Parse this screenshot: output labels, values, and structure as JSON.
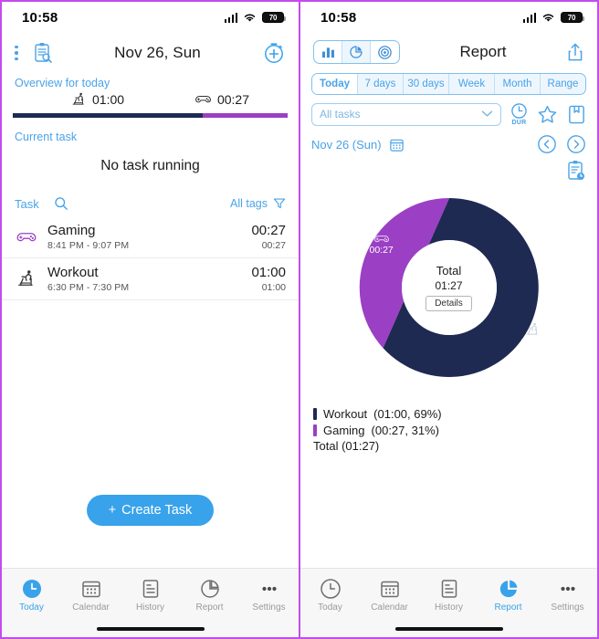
{
  "colors": {
    "accent_blue": "#38a2ea",
    "light_blue": "#4aa3e8",
    "navy": "#1e2a52",
    "purple": "#9b3fc4",
    "frame_border": "#c44bf0"
  },
  "status_bar": {
    "time": "10:58",
    "battery": "70"
  },
  "left": {
    "header": {
      "title": "Nov 26, Sun"
    },
    "overview": {
      "label": "Overview for today",
      "items": [
        {
          "icon": "treadmill-icon",
          "value": "01:00",
          "percent": 69
        },
        {
          "icon": "gamepad-icon",
          "value": "00:27",
          "percent": 31
        }
      ]
    },
    "current_task": {
      "label": "Current task",
      "status": "No task running"
    },
    "task_list": {
      "header_label": "Task",
      "tags_label": "All tags",
      "rows": [
        {
          "icon": "gamepad-icon",
          "name": "Gaming",
          "range": "8:41 PM - 9:07 PM",
          "duration": "00:27",
          "sub": "00:27"
        },
        {
          "icon": "treadmill-icon",
          "name": "Workout",
          "range": "6:30 PM - 7:30 PM",
          "duration": "01:00",
          "sub": "01:00"
        }
      ]
    },
    "create_button": {
      "plus": "+",
      "label": "Create Task"
    },
    "tabs": [
      {
        "label": "Today",
        "icon": "clock-icon",
        "active": true
      },
      {
        "label": "Calendar",
        "icon": "calendar-icon",
        "active": false
      },
      {
        "label": "History",
        "icon": "document-icon",
        "active": false
      },
      {
        "label": "Report",
        "icon": "pie-chart-icon",
        "active": false
      },
      {
        "label": "Settings",
        "icon": "ellipsis-icon",
        "active": false
      }
    ]
  },
  "right": {
    "header": {
      "title": "Report"
    },
    "chart_type_tabs": [
      {
        "icon": "bar-chart-icon",
        "active": false
      },
      {
        "icon": "pie-chart-icon",
        "active": true
      },
      {
        "icon": "target-icon",
        "active": false
      }
    ],
    "period_tabs": [
      {
        "label": "Today",
        "active": true
      },
      {
        "label": "7 days",
        "active": false
      },
      {
        "label": "30 days",
        "active": false
      },
      {
        "label": "Week",
        "active": false
      },
      {
        "label": "Month",
        "active": false
      },
      {
        "label": "Range",
        "active": false
      }
    ],
    "task_filter": {
      "value": "All tasks"
    },
    "dur_toggle": {
      "label": "DUR",
      "icon": "clock-icon"
    },
    "date_nav": {
      "date": "Nov 26 (Sun)",
      "prev": "‹",
      "next": "›"
    },
    "donut_center": {
      "title": "Total",
      "value": "01:27",
      "details_label": "Details"
    },
    "slice_labels": [
      {
        "icon": "gamepad-icon",
        "value": "00:27"
      },
      {
        "icon": "treadmill-icon",
        "value": "01:00"
      }
    ],
    "legend": [
      {
        "name": "Workout",
        "detail": "(01:00, 69%)",
        "color": "#1e2a52"
      },
      {
        "name": "Gaming",
        "detail": "(00:27, 31%)",
        "color": "#9b3fc4"
      }
    ],
    "legend_total": "Total (01:27)",
    "tabs": [
      {
        "label": "Today",
        "icon": "clock-icon",
        "active": false
      },
      {
        "label": "Calendar",
        "icon": "calendar-icon",
        "active": false
      },
      {
        "label": "History",
        "icon": "document-icon",
        "active": false
      },
      {
        "label": "Report",
        "icon": "pie-chart-icon",
        "active": true
      },
      {
        "label": "Settings",
        "icon": "ellipsis-icon",
        "active": false
      }
    ]
  },
  "chart_data": {
    "type": "pie",
    "title": "Total",
    "center_value": "01:27",
    "categories": [
      "Workout",
      "Gaming"
    ],
    "values": [
      60,
      27
    ],
    "value_labels": [
      "01:00",
      "00:27"
    ],
    "percentages": [
      69,
      31
    ],
    "colors": [
      "#1e2a52",
      "#9b3fc4"
    ],
    "units": "minutes",
    "donut": true,
    "legend_position": "below",
    "start_angle_deg": 0,
    "direction": "clockwise"
  }
}
